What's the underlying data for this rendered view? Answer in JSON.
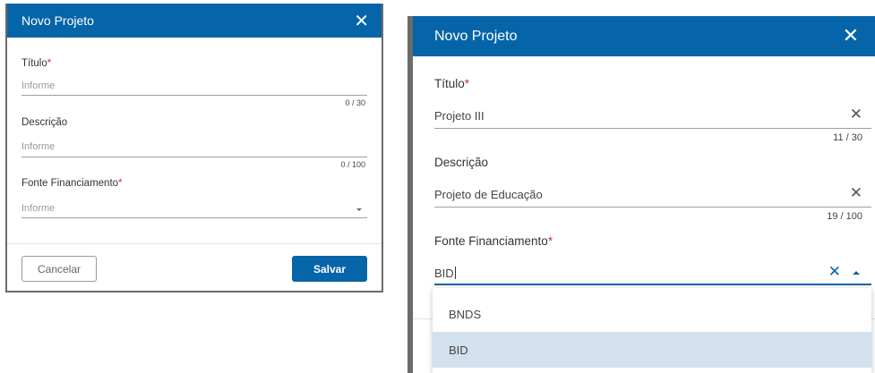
{
  "left_dialog": {
    "title": "Novo Projeto",
    "titulo_label": "Título",
    "titulo_placeholder": "Informe",
    "titulo_count": "0 / 30",
    "descricao_label": "Descrição",
    "descricao_placeholder": "Informe",
    "descricao_count": "0 / 100",
    "fonte_label": "Fonte Financiamento",
    "fonte_placeholder": "Informe",
    "required_mark": "*",
    "cancel_label": "Cancelar",
    "save_label": "Salvar"
  },
  "right_dialog": {
    "title": "Novo Projeto",
    "titulo_label": "Título",
    "titulo_value": "Projeto III",
    "titulo_count": "11 / 30",
    "descricao_label": "Descrição",
    "descricao_value": "Projeto de Educação",
    "descricao_count": "19 / 100",
    "fonte_label": "Fonte Financiamento",
    "fonte_value": "BID",
    "required_mark": "*",
    "options": [
      "BNDS",
      "BID"
    ],
    "selected_option": "BID"
  },
  "icons": {
    "close": "✕",
    "clear": "✕"
  },
  "colors": {
    "header": "#0665a8",
    "required": "#d32f2f",
    "selected_option_bg": "#d3e1ee"
  }
}
